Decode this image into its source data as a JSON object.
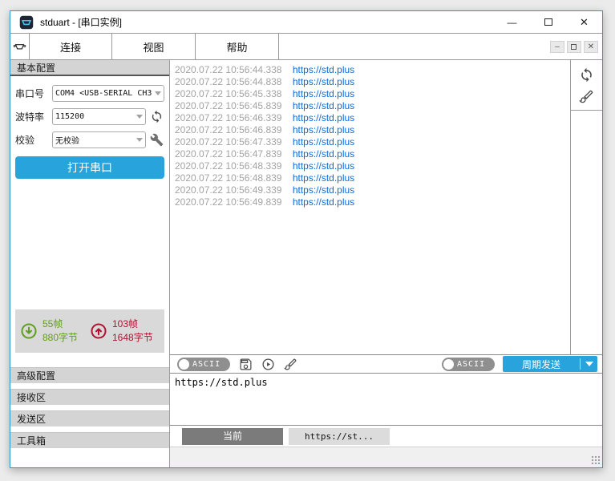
{
  "window": {
    "title": "stduart - [串口实例]"
  },
  "menu": {
    "items": [
      {
        "label": "连接"
      },
      {
        "label": "视图"
      },
      {
        "label": "帮助"
      }
    ]
  },
  "sidebar": {
    "basic_config_header": "基本配置",
    "fields": [
      {
        "label": "串口号",
        "value": "COM4 <USB-SERIAL CH3"
      },
      {
        "label": "波特率",
        "value": "115200"
      },
      {
        "label": "校验",
        "value": "无校验"
      }
    ],
    "open_port_button": "打开串口",
    "stats": {
      "rx_frames": "55帧",
      "rx_bytes": "880字节",
      "tx_frames": "103帧",
      "tx_bytes": "1648字节"
    },
    "sections": [
      {
        "label": "高级配置"
      },
      {
        "label": "接收区"
      },
      {
        "label": "发送区"
      },
      {
        "label": "工具箱"
      }
    ]
  },
  "log": {
    "entries": [
      {
        "timestamp": "2020.07.22 10:56:44.338",
        "url": "https://std.plus"
      },
      {
        "timestamp": "2020.07.22 10:56:44.838",
        "url": "https://std.plus"
      },
      {
        "timestamp": "2020.07.22 10:56:45.338",
        "url": "https://std.plus"
      },
      {
        "timestamp": "2020.07.22 10:56:45.839",
        "url": "https://std.plus"
      },
      {
        "timestamp": "2020.07.22 10:56:46.339",
        "url": "https://std.plus"
      },
      {
        "timestamp": "2020.07.22 10:56:46.839",
        "url": "https://std.plus"
      },
      {
        "timestamp": "2020.07.22 10:56:47.339",
        "url": "https://std.plus"
      },
      {
        "timestamp": "2020.07.22 10:56:47.839",
        "url": "https://std.plus"
      },
      {
        "timestamp": "2020.07.22 10:56:48.339",
        "url": "https://std.plus"
      },
      {
        "timestamp": "2020.07.22 10:56:48.839",
        "url": "https://std.plus"
      },
      {
        "timestamp": "2020.07.22 10:56:49.339",
        "url": "https://std.plus"
      },
      {
        "timestamp": "2020.07.22 10:56:49.839",
        "url": "https://std.plus"
      }
    ]
  },
  "receive_toolbar": {
    "ascii_toggle": "ASCII"
  },
  "send_toolbar": {
    "ascii_toggle": "ASCII",
    "periodic_send_button": "周期发送"
  },
  "send_area": {
    "text": "https://std.plus"
  },
  "tabs": [
    {
      "label": "当前"
    },
    {
      "label": "https://st..."
    }
  ],
  "colors": {
    "accent_blue": "#29a3dc",
    "window_border_blue": "#2b99d8",
    "rx_green": "#5f9e1e",
    "tx_red": "#b01330",
    "link_blue": "#0d6bd8",
    "timestamp_gray": "#a3a3a3"
  }
}
